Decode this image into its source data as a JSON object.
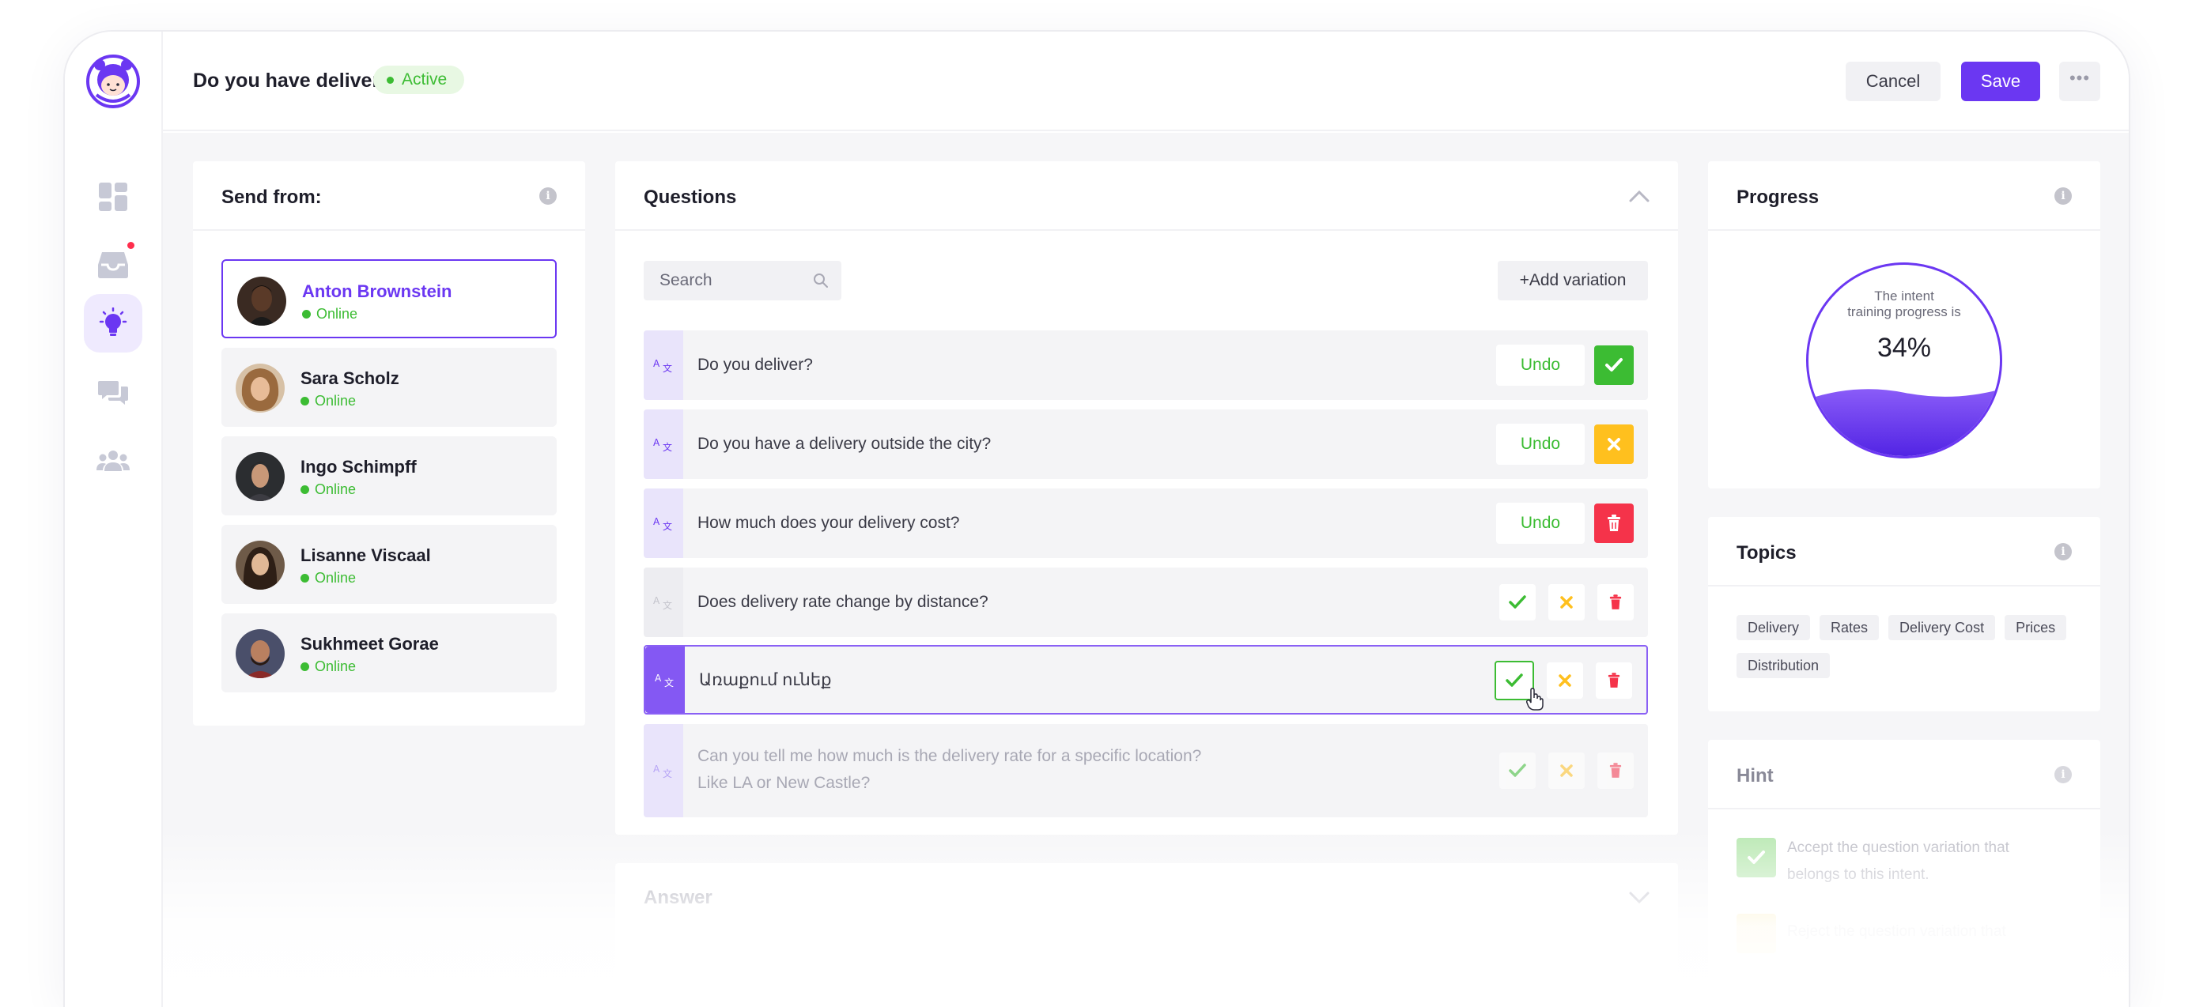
{
  "header": {
    "title": "Do you have delivery?",
    "status": "Active",
    "cancel_label": "Cancel",
    "save_label": "Save",
    "more_label": "•••"
  },
  "nav": {
    "items": [
      "dashboard-icon",
      "inbox-icon",
      "lightbulb-icon",
      "chat-icon",
      "users-icon"
    ],
    "active": "lightbulb-icon"
  },
  "send_from": {
    "title": "Send from:",
    "senders": [
      {
        "name": "Anton Brownstein",
        "status": "Online",
        "selected": true
      },
      {
        "name": "Sara Scholz",
        "status": "Online"
      },
      {
        "name": "Ingo Schimpff",
        "status": "Online"
      },
      {
        "name": "Lisanne Viscaal",
        "status": "Online"
      },
      {
        "name": "Sukhmeet Gorae",
        "status": "Online"
      }
    ]
  },
  "questions": {
    "title": "Questions",
    "search_placeholder": "Search",
    "add_variation_label": "+Add variation",
    "undo_label": "Undo",
    "items": [
      {
        "text": "Do you deliver?",
        "state": "accepted"
      },
      {
        "text": "Do you have a delivery outside the city?",
        "state": "rejected"
      },
      {
        "text": "How much does your delivery cost?",
        "state": "deleted"
      },
      {
        "text": "Does delivery rate change by distance?",
        "state": "pending"
      },
      {
        "text": "Առաքում ունեք",
        "state": "editing"
      },
      {
        "text_line1": "Can you tell me how much is the delivery rate for a specific location?",
        "text_line2": "Like LA or New Castle?",
        "state": "faded"
      }
    ]
  },
  "answer": {
    "title": "Answer"
  },
  "progress": {
    "title": "Progress",
    "label_line1": "The intent",
    "label_line2": "training progress is",
    "value": "34%",
    "fraction": 0.34
  },
  "topics": {
    "title": "Topics",
    "tags": [
      "Delivery",
      "Rates",
      "Delivery Cost",
      "Prices",
      "Distribution"
    ]
  },
  "hint": {
    "title": "Hint",
    "line1": "Accept the question variation that",
    "line2": "belongs to this intent.",
    "line3": "Reject the question variation that"
  },
  "colors": {
    "accent": "#6b37f2",
    "success": "#3cbc33",
    "warning": "#ffc01e",
    "danger": "#f5334a"
  }
}
